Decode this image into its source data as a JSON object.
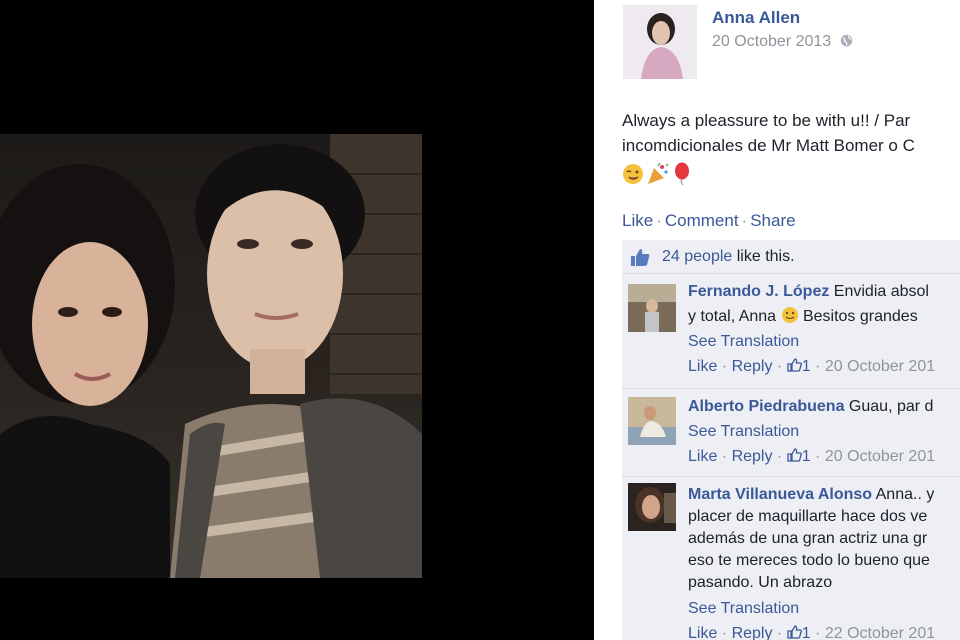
{
  "post": {
    "author": "Anna Allen",
    "date": "20 October 2013",
    "audience_icon": "globe-icon",
    "text_line1": "Always a pleassure to be with u!! / Par",
    "text_line2": "incomdicionales de Mr Matt Bomer o C",
    "emojis": [
      "wink-face-emoji",
      "party-popper-emoji",
      "balloon-emoji"
    ]
  },
  "actions": {
    "like": "Like",
    "comment": "Comment",
    "share": "Share",
    "separator": "·"
  },
  "likes": {
    "count_text": "24 people",
    "suffix": " like this."
  },
  "comments": [
    {
      "name": "Fernando J. López",
      "lines": [
        " Envidia absol",
        "y total, Anna "
      ],
      "line2_suffix": " Besitos grandes",
      "see_translation": "See Translation",
      "like": "Like",
      "reply": "Reply",
      "like_count": "1",
      "date": "20 October 201"
    },
    {
      "name": "Alberto Piedrabuena",
      "lines": [
        " Guau, par d"
      ],
      "see_translation": "See Translation",
      "like": "Like",
      "reply": "Reply",
      "like_count": "1",
      "date": "20 October 201"
    },
    {
      "name": "Marta Villanueva Alonso",
      "lines": [
        " Anna.. y",
        "placer de maquillarte hace dos ve",
        "además de una gran actriz una gr",
        "eso te mereces todo lo bueno que",
        "pasando. Un abrazo"
      ],
      "see_translation": "See Translation",
      "like": "Like",
      "reply": "Reply",
      "like_count": "1",
      "date": "22 October 201"
    }
  ],
  "colors": {
    "link": "#3b5998",
    "muted": "#90949c",
    "comment_bg": "#edeff4"
  }
}
